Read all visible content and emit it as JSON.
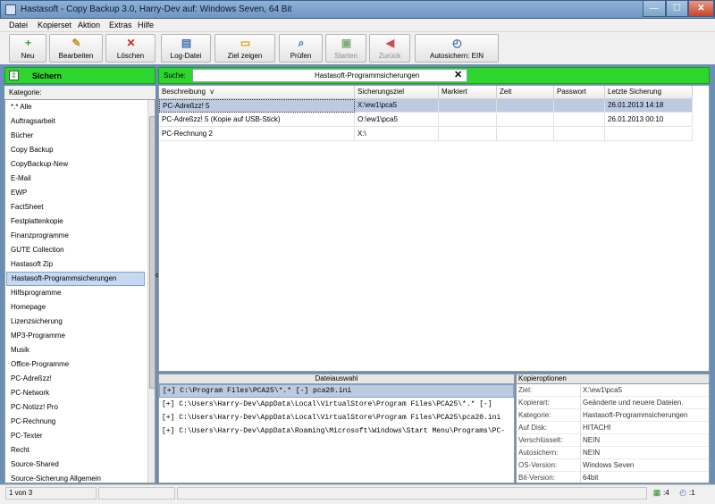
{
  "window": {
    "title": "Hastasoft - Copy Backup 3.0, Harry-Dev auf: Windows Seven, 64 Bit",
    "min_glyph": "—",
    "max_glyph": "☐",
    "close_glyph": "✕"
  },
  "menu": [
    "Datei",
    "Kopierset",
    "Aktion",
    "Extras",
    "Hilfe"
  ],
  "toolbar": {
    "buttons": [
      {
        "label": "Neu",
        "icon": "plus-icon",
        "glyph": "+",
        "color": "#2ca52c"
      },
      {
        "label": "Bearbeiten",
        "icon": "edit-icon",
        "glyph": "✎",
        "color": "#c98a1e"
      },
      {
        "label": "Löschen",
        "icon": "delete-icon",
        "glyph": "✕",
        "color": "#d02020"
      },
      {
        "label": "Log-Datei",
        "icon": "log-file-icon",
        "glyph": "▤",
        "color": "#3a6fb5"
      },
      {
        "label": "Ziel zeigen",
        "icon": "folder-icon",
        "glyph": "▭",
        "color": "#d6a519"
      },
      {
        "label": "Prüfen",
        "icon": "check-icon",
        "glyph": "⌕",
        "color": "#3a6fb5"
      },
      {
        "label": "Starten",
        "icon": "start-icon",
        "glyph": "▣",
        "color": "#7bab7b"
      },
      {
        "label": "Zurück",
        "icon": "back-icon",
        "glyph": "◀",
        "color": "#d05050"
      },
      {
        "label": "Autosichern: EIN",
        "icon": "timer-icon",
        "glyph": "◴",
        "color": "#3a6fb5"
      }
    ]
  },
  "section": {
    "title": "Sichern",
    "search_label": "Suche:",
    "search_value": "",
    "clear_glyph": "✕",
    "current_folder": "Hastasoft-Programmsicherungen",
    "accent": "#2fd52f"
  },
  "categories": {
    "header": "Kategorie:",
    "items": [
      "*.* Alle",
      "Auftragsarbeit",
      "Bücher",
      "Copy Backup",
      "CopyBackup-New",
      "E-Mail",
      "EWP",
      "FactSheet",
      "Festplattenkopie",
      "Finanzprogramme",
      "GUTE Collection",
      "Hastasoft Zip",
      "Hastasoft-Programmsicherungen",
      "Hilfsprogramme",
      "Homepage",
      "Lizenzsicherung",
      "MP3-Programme",
      "Musik",
      "Office-Programme",
      "PC-Adreßzz!",
      "PC-Network",
      "PC-Notizz! Pro",
      "PC-Rechnung",
      "PC-Texter",
      "Recht",
      "Source-Shared",
      "Source-Sicherung Allgemein"
    ],
    "selected_index": 12
  },
  "table": {
    "columns": [
      "Beschreibung",
      "Sicherungsziel",
      "Markiert",
      "Zeit",
      "Passwort",
      "Letzte Sicherung"
    ],
    "rows": [
      [
        "PC-Adreßzz! 5",
        "X:\\ew1\\pca5",
        "",
        "",
        "",
        "26.01.2013  14:18"
      ],
      [
        "PC-Adreßzz! 5 (Kopie auf USB-Stick)",
        "O:\\ew1\\pca5",
        "",
        "",
        "",
        "26.01.2013  00:10"
      ],
      [
        "PC-Rechnung 2",
        "X:\\",
        "",
        "",
        "",
        ""
      ]
    ],
    "sort_marker": "v",
    "selected_row": 0
  },
  "files": {
    "header": "Dateiauswahl",
    "rows": [
      "[+] C:\\Program Files\\PCA25\\*.* [-] pca20.ini",
      "[+] C:\\Users\\Harry-Dev\\AppData\\Local\\VirtualStore\\Program Files\\PCA25\\*.* [-]",
      "[+] C:\\Users\\Harry-Dev\\AppData\\Local\\VirtualStore\\Program Files\\PCA25\\pca20.ini",
      "[+] C:\\Users\\Harry-Dev\\AppData\\Roaming\\Microsoft\\Windows\\Start Menu\\Programs\\PC-"
    ],
    "selected_row": 0
  },
  "options": {
    "header": "Kopieroptionen",
    "rows": [
      {
        "key": "Ziel:",
        "value": "X:\\ew1\\pca5"
      },
      {
        "key": "Kopierart:",
        "value": "Geänderte und neuere Dateien."
      },
      {
        "key": "Kategorie:",
        "value": "Hastasoft-Programmsicherungen"
      },
      {
        "key": "Auf Disk:",
        "value": "HITACHI"
      },
      {
        "key": "Verschlüsselt:",
        "value": "NEIN"
      },
      {
        "key": "Autosichern:",
        "value": "NEIN"
      },
      {
        "key": "OS-Version:",
        "value": "Windows Seven"
      },
      {
        "key": "Bit-Version:",
        "value": "64bit"
      }
    ]
  },
  "status": {
    "record": "1 von 3",
    "save_count": ":4",
    "timer_count": ":1",
    "save_glyph": "▦",
    "timer_glyph": "◴"
  }
}
